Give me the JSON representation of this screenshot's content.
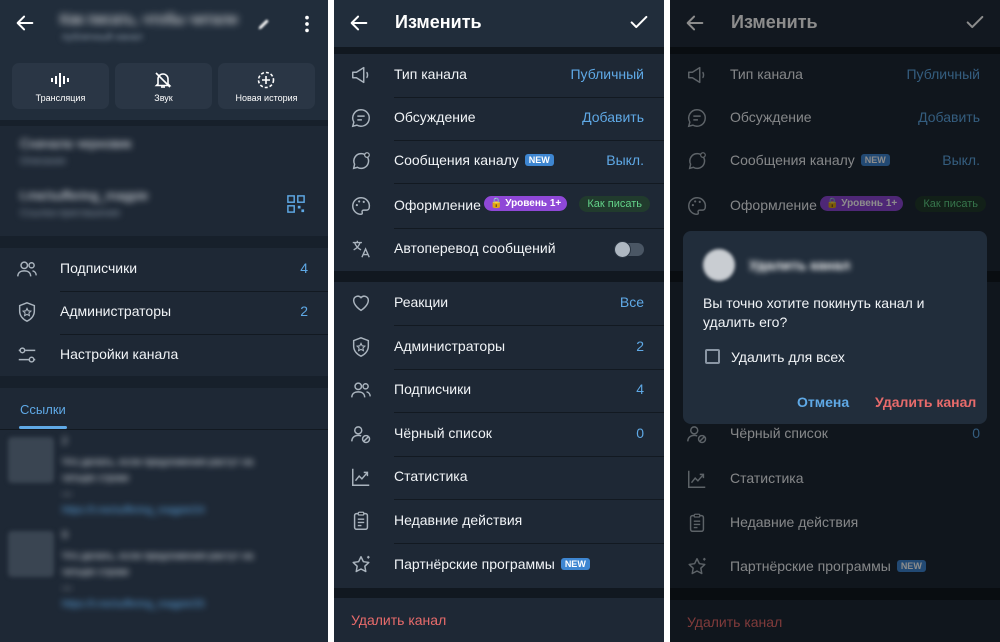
{
  "channel": {
    "title": "Как писать, чтобы читали",
    "subtitle": "публичный канал",
    "actions": [
      {
        "label": "Трансляция",
        "icon": "broadcast-icon"
      },
      {
        "label": "Звук",
        "icon": "mute-bell-icon"
      },
      {
        "label": "Новая история",
        "icon": "new-story-icon"
      }
    ],
    "info": {
      "desc_title": "Сначала черновик",
      "desc_sub": "Описание",
      "link_title": "t.me/suffering_magpie",
      "link_sub": "Ссылка-приглашение"
    },
    "rows": [
      {
        "label": "Подписчики",
        "value": "4"
      },
      {
        "label": "Администраторы",
        "value": "2"
      },
      {
        "label": "Настройки канала",
        "value": ""
      }
    ],
    "links_tab": "Ссылки",
    "links": [
      {
        "count": "2",
        "text1": "Что делать, если предложения растут на",
        "text2": "четыре строки",
        "dash": "—",
        "url": "https://t.me/suffering_magpie/24"
      },
      {
        "count": "9",
        "text1": "Что делать, если предложения растут на",
        "text2": "четыре строки",
        "dash": "—",
        "url": "https://t.me/suffering_magpie/25"
      }
    ]
  },
  "edit": {
    "title": "Изменить",
    "section1": [
      {
        "label": "Тип канала",
        "value": "Публичный"
      },
      {
        "label": "Обсуждение",
        "value": "Добавить"
      },
      {
        "label": "Сообщения каналу",
        "badge": "NEW",
        "value": "Выкл."
      },
      {
        "label": "Оформление",
        "level_badge": "Уровень 1+",
        "chip": "Как писать"
      },
      {
        "label": "Автоперевод сообщений",
        "toggle": "locked-off"
      }
    ],
    "section2": [
      {
        "label": "Реакции",
        "value": "Все"
      },
      {
        "label": "Администраторы",
        "value": "2"
      },
      {
        "label": "Подписчики",
        "value": "4"
      },
      {
        "label": "Чёрный список",
        "value": "0"
      },
      {
        "label": "Статистика",
        "value": ""
      },
      {
        "label": "Недавние действия",
        "value": ""
      },
      {
        "label": "Партнёрские программы",
        "badge": "NEW"
      }
    ],
    "delete_label": "Удалить канал"
  },
  "dialog": {
    "title": "Удалить канал",
    "message": "Вы точно хотите покинуть канал и удалить его?",
    "checkbox_label": "Удалить для всех",
    "cancel": "Отмена",
    "confirm": "Удалить канал"
  },
  "colors": {
    "accent": "#5fa9e6",
    "danger": "#e86b6b",
    "new_badge": "#3e86d1",
    "level_badge": "#8f48d7",
    "chip_green": "#63d389",
    "header_bg": "#212d3b",
    "section_bg": "#1e2835"
  }
}
